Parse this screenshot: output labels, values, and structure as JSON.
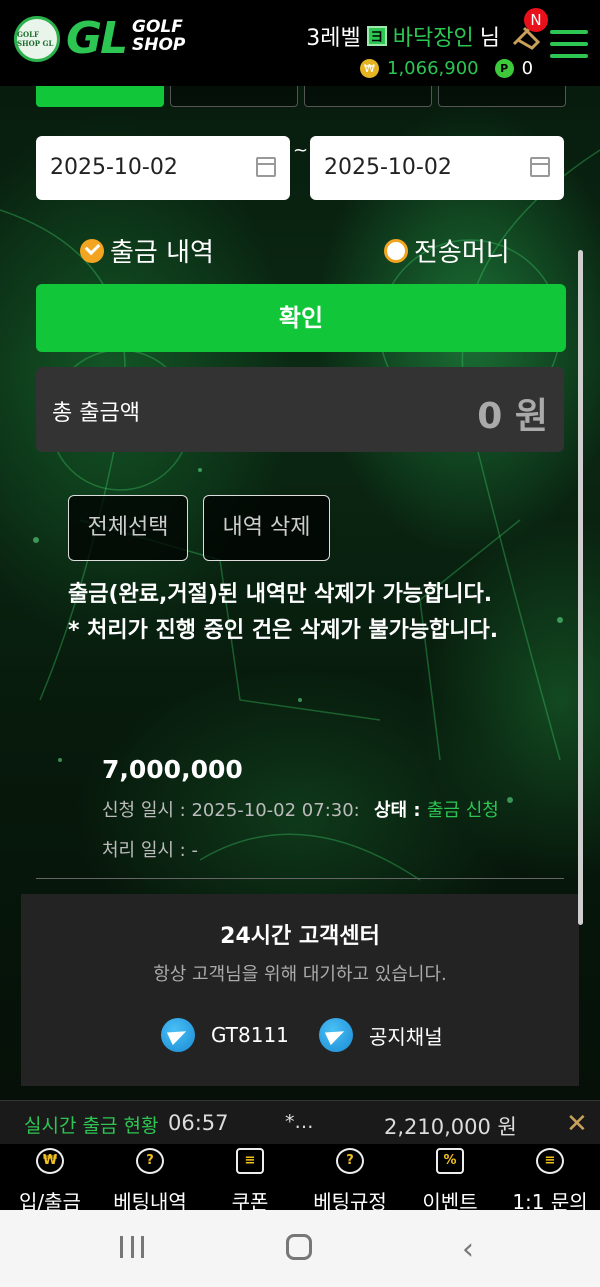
{
  "header": {
    "logo_badge_text": "GOLF SHOP GL",
    "logo_mark": "GL",
    "logo_word_1": "GOLF",
    "logo_word_2": "SHOP",
    "level_text": "3레벨",
    "level_badge": "ヨ",
    "nickname": "바닥장인",
    "honorific": "님",
    "notification_badge": "N",
    "money": "1,066,900",
    "coin_icon": "₩",
    "point_icon": "P",
    "point": "0"
  },
  "filter": {
    "date_from": "2025-10-02",
    "date_to": "2025-10-02",
    "separator": "~",
    "radio_withdraw": "출금 내역",
    "radio_transfer": "전송머니",
    "confirm_label": "확인"
  },
  "summary": {
    "total_label": "총 출금액",
    "total_value": "0 원"
  },
  "actions": {
    "select_all": "전체선택",
    "delete": "내역 삭제"
  },
  "notice": {
    "line1": "출금(완료,거절)된 내역만 삭제가 가능합니다.",
    "line2": "* 처리가 진행 중인 건은 삭제가 불가능합니다."
  },
  "history": [
    {
      "amount": "7,000,000",
      "request_label": "신청 일시 : 2025-10-02 07:30:",
      "status_label": "상태 : ",
      "status_value": "출금 신청",
      "processed_label": "처리 일시 : -"
    }
  ],
  "customer_center": {
    "title": "24시간 고객센터",
    "subtitle": "항상 고객님을 위해 대기하고 있습니다.",
    "channel1": "GT8111",
    "channel2": "공지채널"
  },
  "ticker": {
    "title": "실시간 출금 현황",
    "time": "06:57",
    "name": "*…",
    "amount": "2,210,000 원",
    "close": "✕"
  },
  "bottom_nav": [
    {
      "label": "입/출금",
      "icon": "₩"
    },
    {
      "label": "베팅내역",
      "icon": "?"
    },
    {
      "label": "쿠폰",
      "icon": "≡"
    },
    {
      "label": "베팅규정",
      "icon": "?"
    },
    {
      "label": "이벤트",
      "icon": "%"
    },
    {
      "label": "1:1 문의",
      "icon": "≡"
    }
  ],
  "colors": {
    "accent_green": "#12c63a",
    "brand_green": "#2dc653",
    "radio_orange": "#f3a521",
    "badge_red": "#e8101a"
  }
}
